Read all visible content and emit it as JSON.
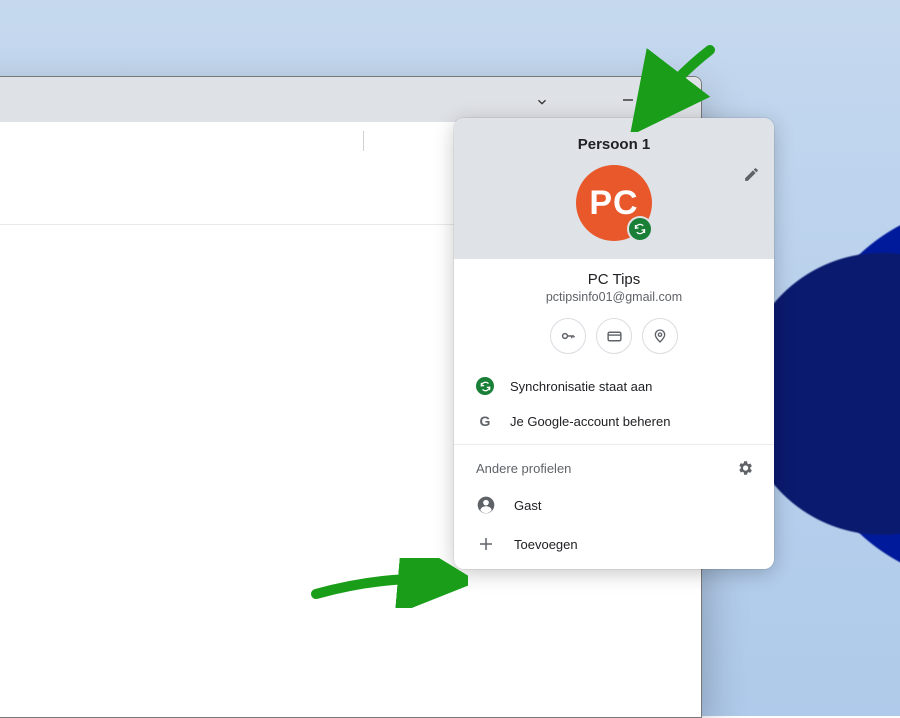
{
  "profile_badge": {
    "initials": "PC"
  },
  "popup": {
    "profile_name": "Persoon 1",
    "avatar_initials": "PC",
    "display_name": "PC Tips",
    "email": "pctipsinfo01@gmail.com",
    "sync_status": "Synchronisatie staat aan",
    "manage_account": "Je Google-account beheren",
    "other_profiles_header": "Andere profielen",
    "guest": "Gast",
    "add": "Toevoegen"
  }
}
